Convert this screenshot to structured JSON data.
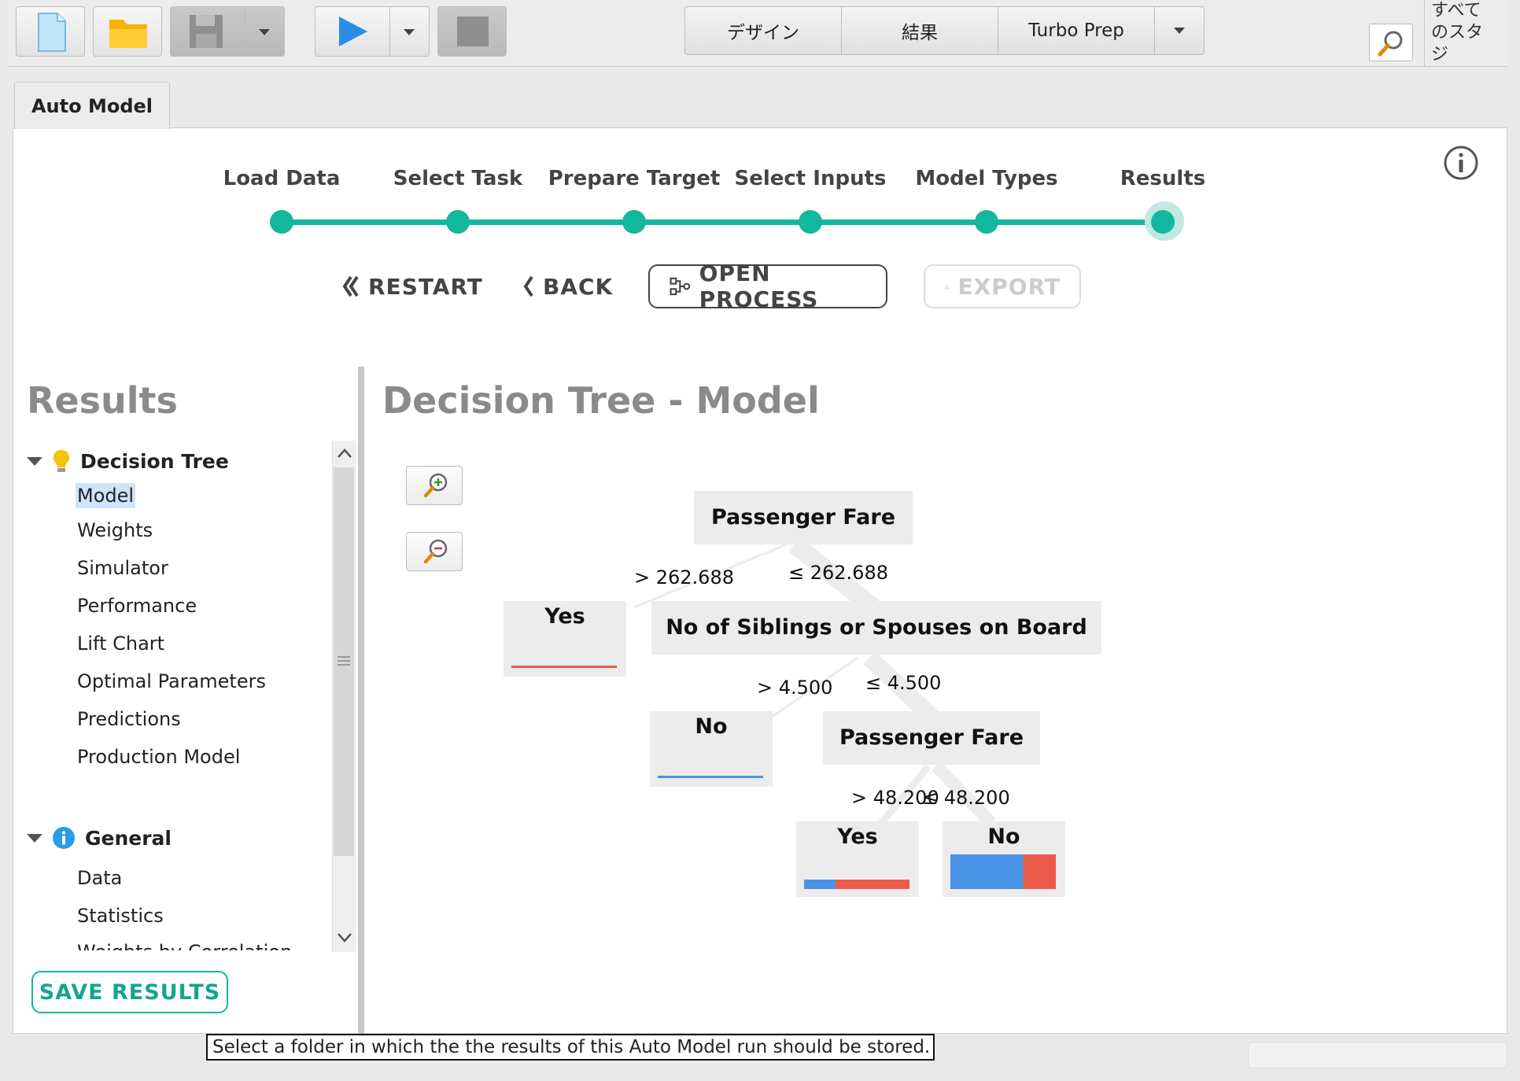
{
  "toolbar": {
    "perspectives": [
      "デザイン",
      "結果",
      "Turbo Prep"
    ],
    "corner_text": "すべて のスタ ジ"
  },
  "tab": {
    "label": "Auto Model"
  },
  "steps": [
    "Load Data",
    "Select Task",
    "Prepare Target",
    "Select Inputs",
    "Model Types",
    "Results"
  ],
  "actions": {
    "restart": "RESTART",
    "back": "BACK",
    "open_process": "OPEN PROCESS",
    "export": "EXPORT"
  },
  "sidebar": {
    "title": "Results",
    "groups": [
      {
        "label": "Decision Tree",
        "icon": "lightbulb-icon",
        "items": [
          "Model",
          "Weights",
          "Simulator",
          "Performance",
          "Lift Chart",
          "Optimal Parameters",
          "Predictions",
          "Production Model"
        ]
      },
      {
        "label": "General",
        "icon": "info-icon",
        "items": [
          "Data",
          "Statistics",
          "Weights by Correlation"
        ]
      }
    ],
    "selected": "Model",
    "save_label": "SAVE RESULTS"
  },
  "main": {
    "title": "Decision Tree - Model",
    "tree": {
      "root": "Passenger Fare",
      "root_left_edge": "> 262.688",
      "root_right_edge": "≤ 262.688",
      "leaf_yes_1": "Yes",
      "node_siblings": "No of Siblings or Spouses on Board",
      "sib_left_edge": "> 4.500",
      "sib_right_edge": "≤ 4.500",
      "leaf_no_1": "No",
      "node_fare_2": "Passenger Fare",
      "fare2_left_edge": "> 48.200",
      "fare2_right_edge": "≤ 48.200",
      "leaf_yes_2": "Yes",
      "leaf_no_2": "No",
      "class_colors": {
        "No": "#4a94e6",
        "Yes": "#ec5a4a"
      },
      "leaf_yes_1_no_fraction": 0.0,
      "leaf_no_1_no_fraction": 1.0,
      "leaf_yes_2_no_fraction": 0.3,
      "leaf_no_2_no_fraction": 0.69
    }
  },
  "tooltip": "Select a folder in which the the results of this Auto Model run should be stored.",
  "colors": {
    "accent": "#13b7a0"
  }
}
